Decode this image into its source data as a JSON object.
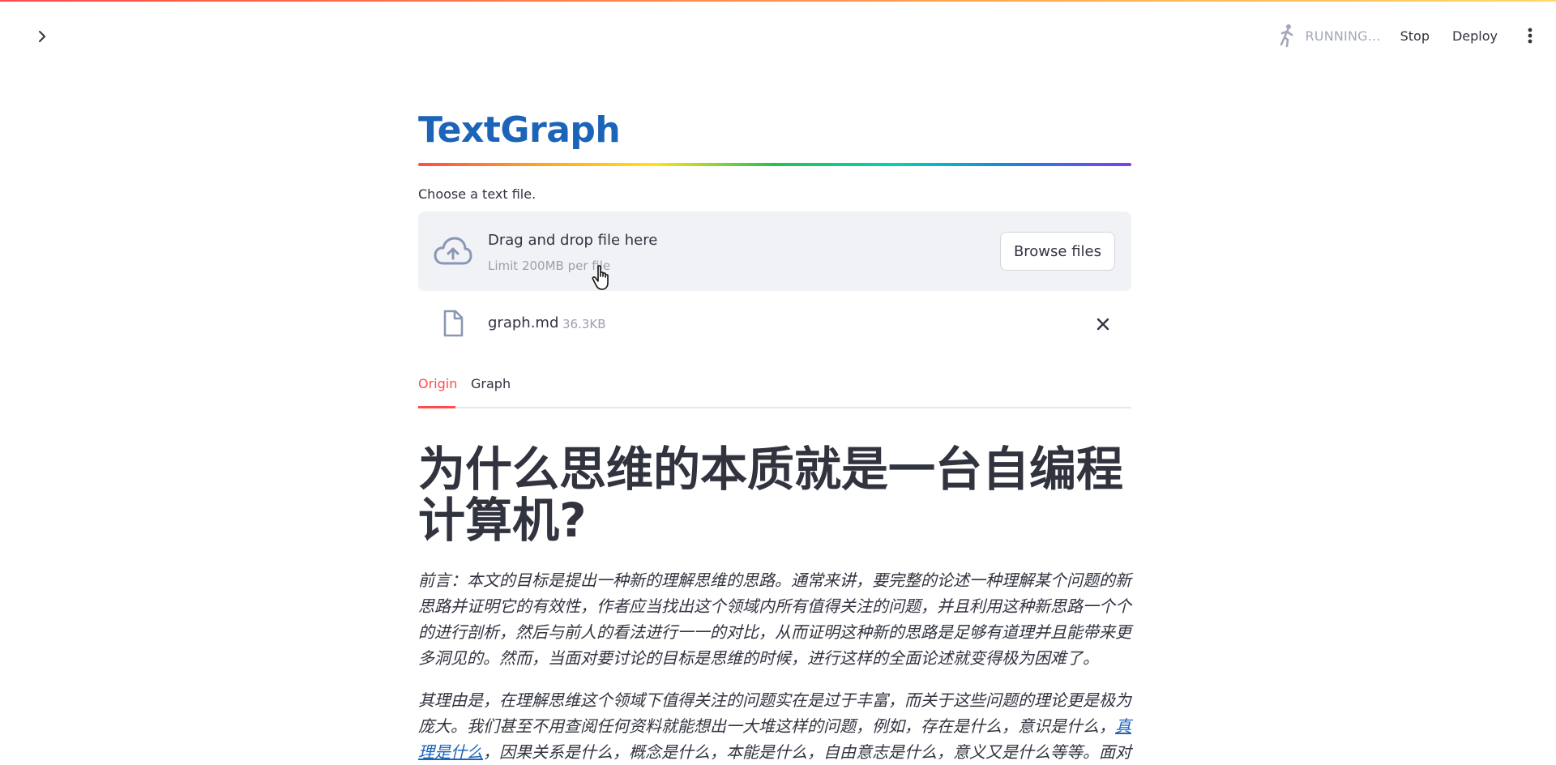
{
  "toolbar": {
    "status": "RUNNING...",
    "stop_label": "Stop",
    "deploy_label": "Deploy"
  },
  "app": {
    "title": "TextGraph"
  },
  "uploader": {
    "label": "Choose a text file.",
    "drop_title": "Drag and drop file here",
    "limit_text": "Limit 200MB per file",
    "browse_label": "Browse files"
  },
  "file": {
    "name": "graph.md",
    "size": "36.3KB"
  },
  "tabs": [
    {
      "label": "Origin",
      "active": true
    },
    {
      "label": "Graph",
      "active": false
    }
  ],
  "document": {
    "heading": "为什么思维的本质就是一台自编程计算机?",
    "paragraph1": "前言：本文的目标是提出一种新的理解思维的思路。通常来讲，要完整的论述一种理解某个问题的新思路并证明它的有效性，作者应当找出这个领域内所有值得关注的问题，并且利用这种新思路一个个的进行剖析，然后与前人的看法进行一一的对比，从而证明这种新的思路是足够有道理并且能带来更多洞见的。然而，当面对要讨论的目标是思维的时候，进行这样的全面论述就变得极为困难了。",
    "paragraph2_before": "其理由是，在理解思维这个领域下值得关注的问题实在是过于丰富，而关于这些问题的理论更是极为庞大。我们甚至不用查阅任何资料就能想出一大堆这样的问题，例如，存在是什么，意识是什么，",
    "paragraph2_link": "真理是什么",
    "paragraph2_after": "，因果关系是什么，概念是什么，本能是什么，自由意志是什么，意义又是什么等等。面对"
  },
  "colors": {
    "accent": "#ff4b4b",
    "title": "#1c64b8",
    "link": "#1c64b8"
  }
}
